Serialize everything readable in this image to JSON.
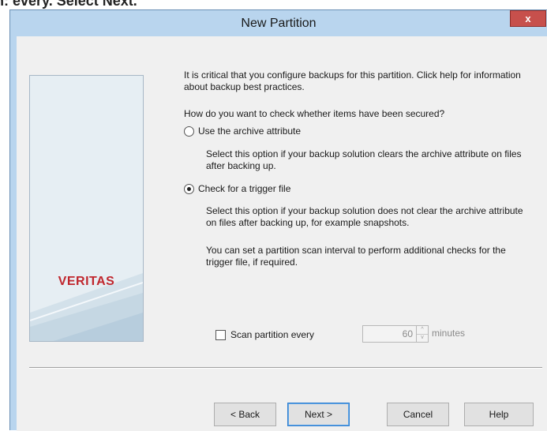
{
  "top_strip": {
    "text": "n: every. Select Next."
  },
  "window": {
    "title": "New Partition",
    "close_label": "x"
  },
  "banner": {
    "logo_text": "VERITAS"
  },
  "content": {
    "intro": "It is critical that you configure backups for this partition. Click help for information about backup best practices.",
    "question": "How do you want to check whether items have been secured?",
    "options": [
      {
        "label": "Use the archive attribute",
        "checked": false,
        "description": "Select this option if your backup solution clears the archive attribute on files after backing up."
      },
      {
        "label": "Check for a trigger file",
        "checked": true,
        "description": "Select this option if your backup solution does not clear the archive attribute on files after backing up, for example snapshots."
      }
    ],
    "scan_note": "You can set a partition scan interval to perform additional checks for the trigger file, if required.",
    "scan": {
      "label": "Scan partition every",
      "checked": false,
      "value": "60",
      "unit": "minutes",
      "up_glyph": "^",
      "down_glyph": "v"
    }
  },
  "buttons": {
    "back": "< Back",
    "next": "Next >",
    "cancel": "Cancel",
    "help": "Help"
  },
  "colors": {
    "titlebar": "#b9d5ee",
    "close_button": "#c7504c",
    "logo": "#c0262d",
    "dialog_background": "#f0f0f0"
  }
}
